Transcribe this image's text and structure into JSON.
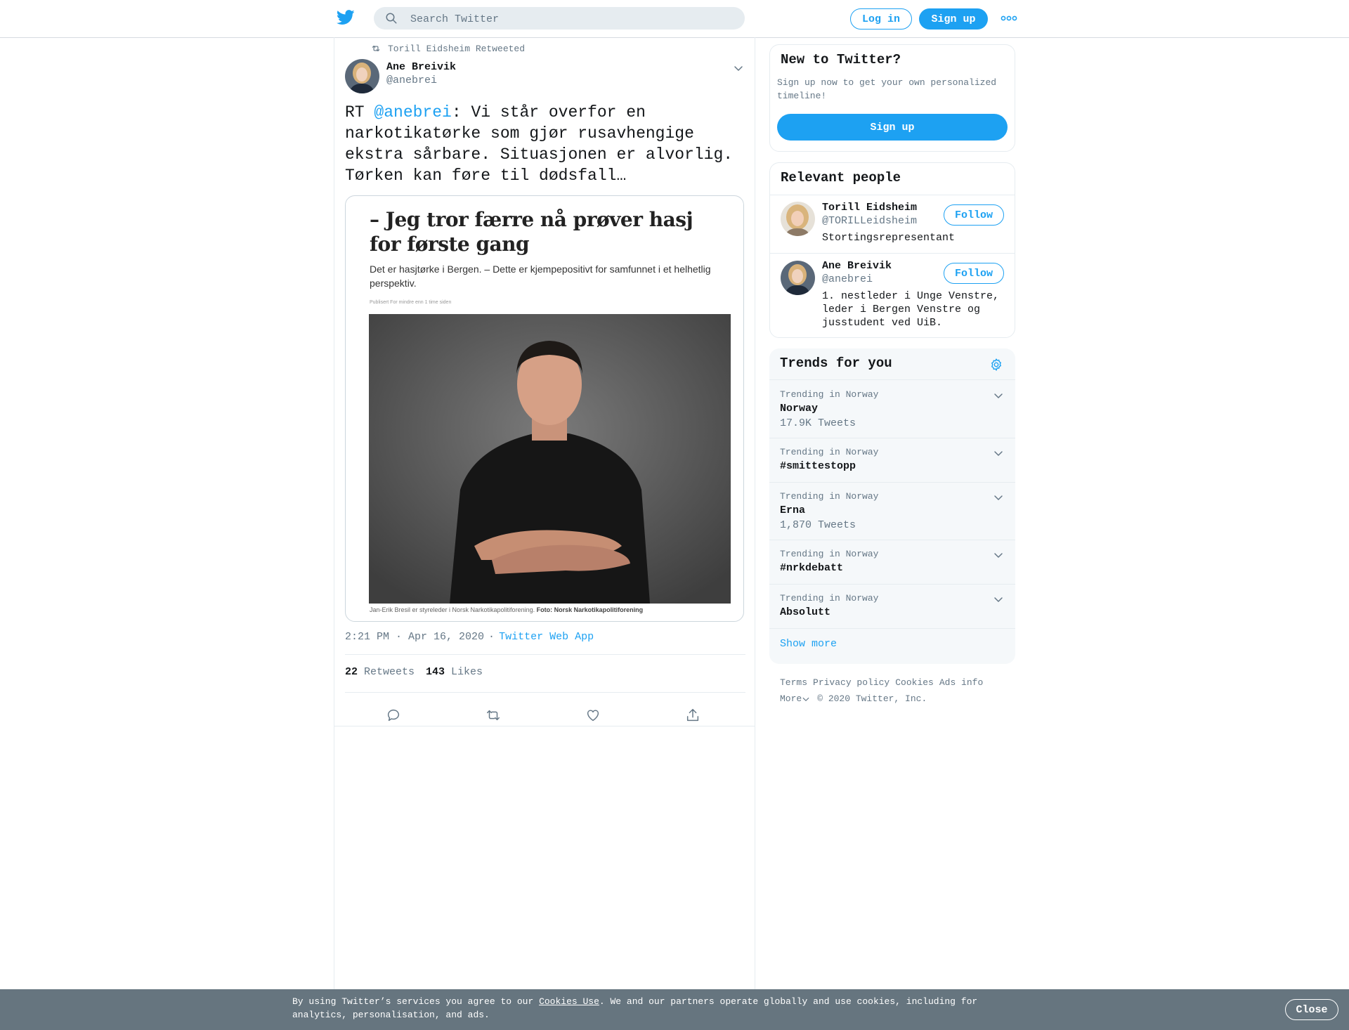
{
  "header": {
    "search_placeholder": "Search Twitter",
    "login_label": "Log in",
    "signup_label": "Sign up",
    "brand_color": "#1da1f2"
  },
  "tweet": {
    "retweeted_by": "Torill Eidsheim Retweeted",
    "author_name": "Ane Breivik",
    "author_handle": "@anebrei",
    "text_prefix": "RT ",
    "mention": "@anebrei",
    "text_body": ": Vi står overfor en narkotikatørke som gjør rusavhengige ekstra sårbare. Situasjonen er alvorlig. Tørken kan føre til dødsfall…",
    "card": {
      "headline": "– Jeg tror færre nå prøver hasj for første gang",
      "lead": "Det er hasjtørke i Bergen. – Dette er kjempepositivt for samfunnet i et helhetlig perspektiv.",
      "published": "Publisert For mindre enn 1 time siden",
      "caption": "Jan-Erik Bresil er styreleder i Norsk Narkotikapolitiforening.",
      "caption_credit": "Foto: Norsk Narkotikapolitiforening"
    },
    "time": "2:21 PM · Apr 16, 2020",
    "separator": "·",
    "source": "Twitter Web App",
    "retweets_count": "22",
    "retweets_label": "Retweets",
    "likes_count": "143",
    "likes_label": "Likes"
  },
  "new_to_twitter": {
    "title": "New to Twitter?",
    "subtitle": "Sign up now to get your own personalized timeline!",
    "signup_label": "Sign up"
  },
  "relevant_people": {
    "title": "Relevant people",
    "people": [
      {
        "name": "Torill Eidsheim",
        "handle": "@TORILLeidsheim",
        "bio": "Stortingsrepresentant",
        "follow_label": "Follow"
      },
      {
        "name": "Ane Breivik",
        "handle": "@anebrei",
        "bio": "1. nestleder i Unge Venstre, leder i Bergen Venstre og jusstudent ved UiB.",
        "follow_label": "Follow"
      }
    ]
  },
  "trends": {
    "title": "Trends for you",
    "items": [
      {
        "category": "Trending in Norway",
        "name": "Norway",
        "count": "17.9K Tweets"
      },
      {
        "category": "Trending in Norway",
        "name": "#smittestopp",
        "count": ""
      },
      {
        "category": "Trending in Norway",
        "name": "Erna",
        "count": "1,870 Tweets"
      },
      {
        "category": "Trending in Norway",
        "name": "#nrkdebatt",
        "count": ""
      },
      {
        "category": "Trending in Norway",
        "name": "Absolutt",
        "count": ""
      }
    ],
    "show_more": "Show more"
  },
  "footer": {
    "links": [
      "Terms",
      "Privacy policy",
      "Cookies",
      "Ads info"
    ],
    "more_label": "More",
    "copyright": "© 2020 Twitter, Inc."
  },
  "cookie_bar": {
    "text_before": "By using Twitter’s services you agree to our ",
    "link": "Cookies Use",
    "text_after": ". We and our partners operate globally and use cookies, including for analytics, personalisation, and ads.",
    "close_label": "Close"
  }
}
